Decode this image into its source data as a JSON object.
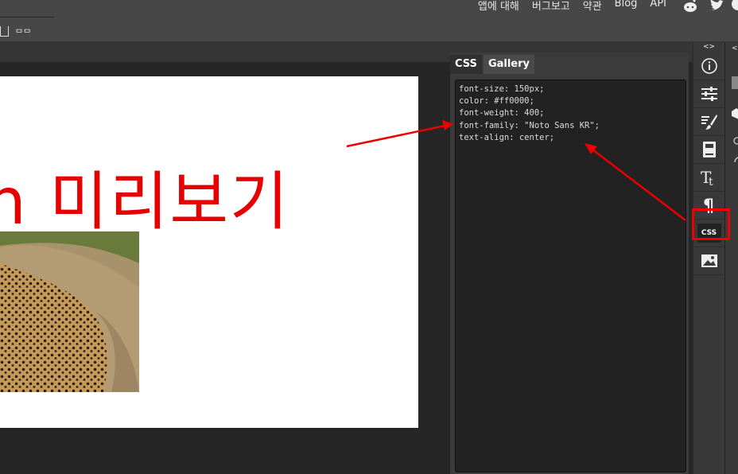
{
  "topnav": {
    "items": [
      {
        "label": "앱에 대해"
      },
      {
        "label": "버그보고"
      },
      {
        "label": "약관"
      },
      {
        "label": "Blog"
      },
      {
        "label": "API"
      }
    ]
  },
  "toolbar_header": "<>",
  "preview": {
    "text": "h 미리보기",
    "color": "#ff0000"
  },
  "panel": {
    "tabs": [
      {
        "label": "CSS"
      },
      {
        "label": "Gallery"
      }
    ],
    "css_lines": [
      "font-size: 150px;",
      "color: #ff0000;",
      "font-weight: 400;",
      "font-family: \"Noto Sans KR\";",
      "text-align: center;"
    ]
  },
  "right_toolbar": {
    "css_button": "CSS",
    "icons": [
      "info-icon",
      "sliders-icon",
      "brush-icon",
      "book-icon",
      "text-tt-icon",
      "pilcrow-icon",
      "css-icon",
      "image-icon"
    ]
  },
  "colors": {
    "accent": "#e60000",
    "background": "#262626",
    "panel": "#3b3b3b"
  }
}
